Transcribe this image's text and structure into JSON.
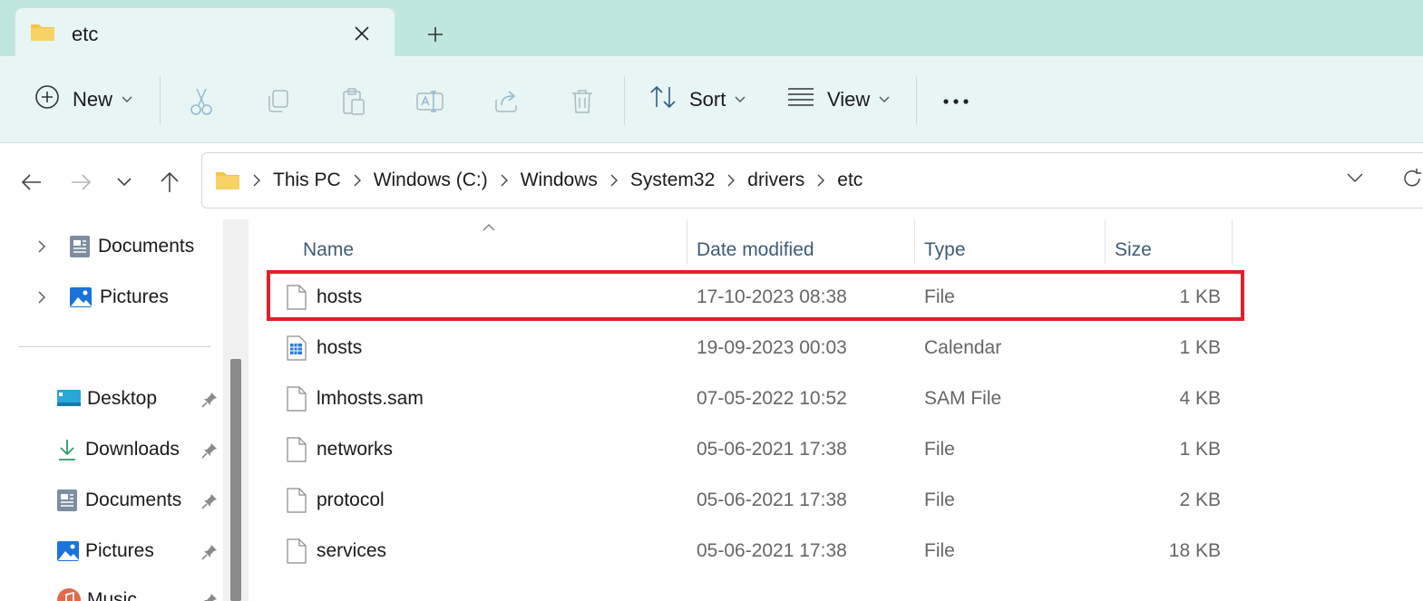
{
  "tab": {
    "title": "etc",
    "close_icon": "close-icon",
    "new_tab_icon": "plus-icon"
  },
  "toolbar": {
    "new_label": "New",
    "sort_label": "Sort",
    "view_label": "View",
    "icons": [
      "cut-icon",
      "copy-icon",
      "paste-icon",
      "rename-icon",
      "share-icon",
      "delete-icon",
      "more-icon"
    ]
  },
  "address": {
    "crumbs": [
      "This PC",
      "Windows (C:)",
      "Windows",
      "System32",
      "drivers",
      "etc"
    ]
  },
  "sidebar": {
    "items": [
      {
        "label": "Documents",
        "icon": "documents-icon"
      },
      {
        "label": "Pictures",
        "icon": "pictures-icon"
      },
      {
        "label": "Desktop",
        "icon": "desktop-icon",
        "pinned": true
      },
      {
        "label": "Downloads",
        "icon": "downloads-icon",
        "pinned": true
      },
      {
        "label": "Documents",
        "icon": "documents-icon",
        "pinned": true
      },
      {
        "label": "Pictures",
        "icon": "pictures-icon",
        "pinned": true
      },
      {
        "label": "Music",
        "icon": "music-icon",
        "pinned": true
      }
    ]
  },
  "columns": {
    "name": "Name",
    "date": "Date modified",
    "type": "Type",
    "size": "Size"
  },
  "files": [
    {
      "name": "hosts",
      "date": "17-10-2023 08:38",
      "type": "File",
      "size": "1 KB",
      "icon": "file-icon",
      "highlighted": true
    },
    {
      "name": "hosts",
      "date": "19-09-2023 00:03",
      "type": "Calendar",
      "size": "1 KB",
      "icon": "calendar-file-icon"
    },
    {
      "name": "lmhosts.sam",
      "date": "07-05-2022 10:52",
      "type": "SAM File",
      "size": "4 KB",
      "icon": "file-icon"
    },
    {
      "name": "networks",
      "date": "05-06-2021 17:38",
      "type": "File",
      "size": "1 KB",
      "icon": "file-icon"
    },
    {
      "name": "protocol",
      "date": "05-06-2021 17:38",
      "type": "File",
      "size": "2 KB",
      "icon": "file-icon"
    },
    {
      "name": "services",
      "date": "05-06-2021 17:38",
      "type": "File",
      "size": "18 KB",
      "icon": "file-icon"
    }
  ],
  "colors": {
    "highlight": "#e0202a",
    "tabstrip": "#bfe6df",
    "toolbar": "#e7f6f4"
  }
}
